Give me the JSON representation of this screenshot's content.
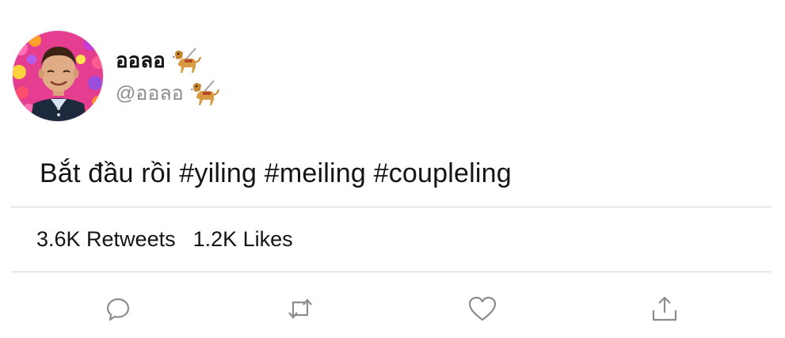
{
  "tweet": {
    "display_name": "ออลอ",
    "handle": "@ออลอ",
    "text": "Bắt đầu rồi  #yiling #meiling #coupleling",
    "name_badge_icon": "guide-dog-emoji",
    "handle_badge_icon": "guide-dog-emoji"
  },
  "stats": {
    "retweets": "3.6K Retweets",
    "likes": "1.2K Likes"
  },
  "actions": {
    "reply_icon": "reply-bubble-icon",
    "retweet_icon": "retweet-arrows-icon",
    "like_icon": "heart-icon",
    "share_icon": "share-upload-icon"
  },
  "colors": {
    "text": "#141414",
    "handle": "#8a8d91",
    "divider": "#d4d4d4",
    "action_icon": "#8a8d91"
  }
}
